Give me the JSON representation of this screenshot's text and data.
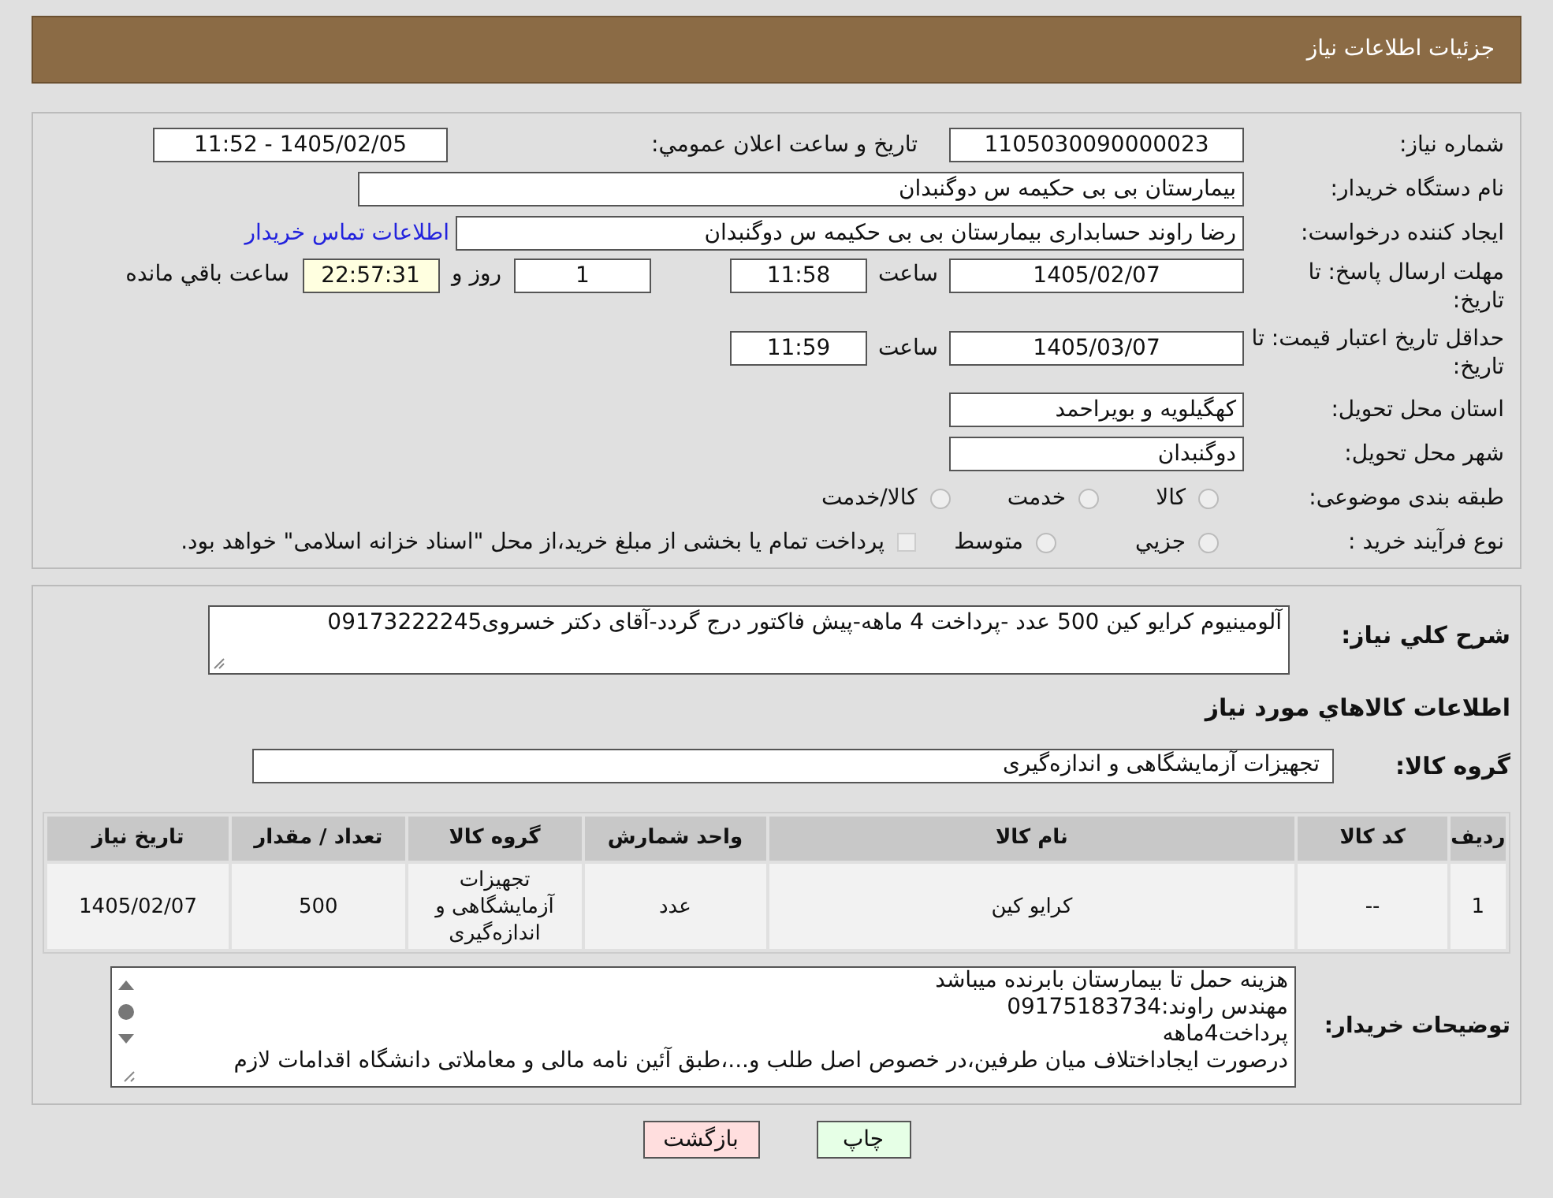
{
  "header": {
    "title": "جزئیات اطلاعات نیاز"
  },
  "need_number": {
    "label": "شماره نیاز:",
    "value": "1105030090000023"
  },
  "announce": {
    "label": "تاریخ و ساعت اعلان عمومي:",
    "value": "1405/02/05 - 11:52"
  },
  "buyer": {
    "label": "نام دستگاه خریدار:",
    "value": "بیمارستان بی بی حکیمه س  دوگنبدان"
  },
  "creator": {
    "label": "ایجاد کننده درخواست:",
    "value": "رضا راوند حسابداری بیمارستان بی بی حکیمه س  دوگنبدان",
    "link": "اطلاعات تماس خریدار"
  },
  "deadline": {
    "label": "مهلت ارسال پاسخ: تا تاریخ:",
    "date": "1405/02/07",
    "time_label": "ساعت",
    "time": "11:58",
    "days": "1",
    "days_label": "روز و",
    "remaining": "22:57:31",
    "remaining_label": "ساعت باقي مانده"
  },
  "validity": {
    "label": "حداقل تاریخ اعتبار قیمت: تا تاریخ:",
    "date": "1405/03/07",
    "time_label": "ساعت",
    "time": "11:59"
  },
  "province": {
    "label": "استان محل تحویل:",
    "value": "کهگیلویه و بویراحمد"
  },
  "city": {
    "label": "شهر محل تحویل:",
    "value": "دوگنبدان"
  },
  "category": {
    "label": "طبقه بندی موضوعی:",
    "options": [
      {
        "label": "کالا",
        "selected": false
      },
      {
        "label": "خدمت",
        "selected": false
      },
      {
        "label": "کالا/خدمت",
        "selected": false
      }
    ]
  },
  "process": {
    "label": "نوع فرآیند خرید :",
    "options": [
      {
        "label": "جزيي",
        "selected": false
      },
      {
        "label": "متوسط",
        "selected": false
      }
    ],
    "checkbox": {
      "checked": false,
      "text": "پرداخت تمام یا بخشی از مبلغ خرید،از محل \"اسناد خزانه اسلامی\" خواهد بود."
    }
  },
  "description": {
    "label": "شرح کلي نیاز:",
    "value": "آلومینیوم  کرایو کین  500  عدد -پرداخت 4 ماهه-پیش فاکتور درج گردد-آقای دکتر خسروی09173222245"
  },
  "goods_title": "اطلاعات کالاهاي مورد نیاز",
  "group": {
    "label": "گروه کالا:",
    "value": "تجهیزات آزمایشگاهی و اندازه‌گیری"
  },
  "table": {
    "columns": [
      "ردیف",
      "کد کالا",
      "نام کالا",
      "واحد شمارش",
      "گروه کالا",
      "تعداد / مقدار",
      "تاریخ نیاز"
    ],
    "rows": [
      [
        "1",
        "--",
        "کرایو کین",
        "عدد",
        "تجهیزات آزمایشگاهی و اندازه‌گیری",
        "500",
        "1405/02/07"
      ]
    ]
  },
  "notes": {
    "label": "توضیحات خریدار:",
    "lines": [
      "هزینه حمل تا بیمارستان بابرنده میباشد",
      "مهندس راوند:09175183734",
      "پرداخت4ماهه",
      "درصورت ایجاداختلاف میان طرفین،در خصوص اصل طلب و...،طبق آئین نامه مالی و معاملاتی دانشگاه اقدامات لازم"
    ]
  },
  "buttons": [
    {
      "label": "چاپ",
      "kind": "print"
    },
    {
      "label": "بازگشت",
      "kind": "back"
    }
  ]
}
